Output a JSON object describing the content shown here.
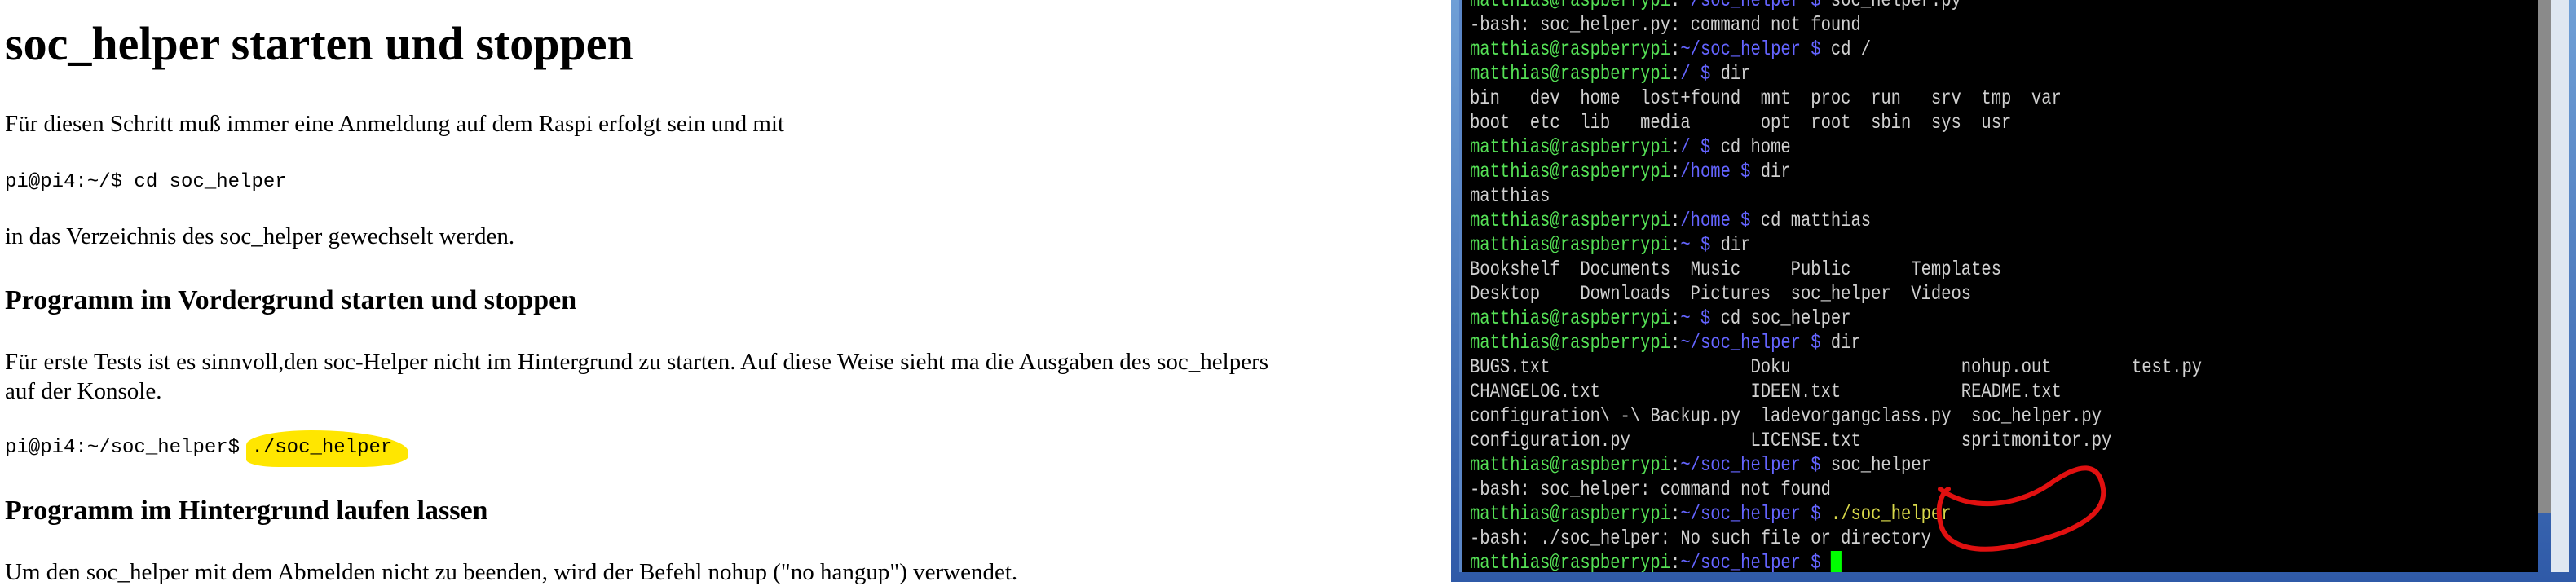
{
  "doc": {
    "title": "soc_helper starten und stoppen",
    "p1": "Für diesen Schritt muß immer eine Anmeldung auf dem Raspi erfolgt sein und mit",
    "code1": "pi@pi4:~/$ cd soc_helper",
    "p2": "in das Verzeichnis des soc_helper gewechselt werden.",
    "h2a": "Programm im Vordergrund starten und stoppen",
    "p3a": "Für erste Tests ist es sinnvoll,den soc-Helper nicht im Hintergrund zu starten. Auf diese Weise sieht ma die Ausgaben des soc_helpers",
    "p3b": "auf der Konsole.",
    "code2_prompt": "pi@pi4:~/soc_helper$ ",
    "code2_cmd": "./soc_helper",
    "h2b": "Programm im Hintergrund laufen lassen",
    "p4": "Um den soc_helper mit dem Abmelden nicht zu beenden, wird der Befehl nohup (\"no hangup\") verwendet."
  },
  "terminal": {
    "colors": {
      "user": "#55e055",
      "path": "#6464ff",
      "text": "#d0d0d0",
      "highlight": "#d8d84a",
      "cursor": "#00ff00",
      "annotation": "#e01010"
    },
    "lines": [
      [
        [
          "g",
          "matthias@raspberrypi"
        ],
        [
          "w",
          ":"
        ],
        [
          "b",
          "~/soc_helper $ "
        ],
        [
          "w",
          "soc_helper.py"
        ]
      ],
      [
        [
          "w",
          "-bash: soc_helper.py: command not found"
        ]
      ],
      [
        [
          "g",
          "matthias@raspberrypi"
        ],
        [
          "w",
          ":"
        ],
        [
          "b",
          "~/soc_helper $ "
        ],
        [
          "w",
          "cd /"
        ]
      ],
      [
        [
          "g",
          "matthias@raspberrypi"
        ],
        [
          "w",
          ":"
        ],
        [
          "b",
          "/ $ "
        ],
        [
          "w",
          "dir"
        ]
      ],
      [
        [
          "w",
          "bin   dev  home  lost+found  mnt  proc  run   srv  tmp  var"
        ]
      ],
      [
        [
          "w",
          "boot  etc  lib   media       opt  root  sbin  sys  usr"
        ]
      ],
      [
        [
          "g",
          "matthias@raspberrypi"
        ],
        [
          "w",
          ":"
        ],
        [
          "b",
          "/ $ "
        ],
        [
          "w",
          "cd home"
        ]
      ],
      [
        [
          "g",
          "matthias@raspberrypi"
        ],
        [
          "w",
          ":"
        ],
        [
          "b",
          "/home $ "
        ],
        [
          "w",
          "dir"
        ]
      ],
      [
        [
          "w",
          "matthias"
        ]
      ],
      [
        [
          "g",
          "matthias@raspberrypi"
        ],
        [
          "w",
          ":"
        ],
        [
          "b",
          "/home $ "
        ],
        [
          "w",
          "cd matthias"
        ]
      ],
      [
        [
          "g",
          "matthias@raspberrypi"
        ],
        [
          "w",
          ":"
        ],
        [
          "b",
          "~ $ "
        ],
        [
          "w",
          "dir"
        ]
      ],
      [
        [
          "w",
          "Bookshelf  Documents  Music     Public      Templates"
        ]
      ],
      [
        [
          "w",
          "Desktop    Downloads  Pictures  soc_helper  Videos"
        ]
      ],
      [
        [
          "g",
          "matthias@raspberrypi"
        ],
        [
          "w",
          ":"
        ],
        [
          "b",
          "~ $ "
        ],
        [
          "w",
          "cd soc_helper"
        ]
      ],
      [
        [
          "g",
          "matthias@raspberrypi"
        ],
        [
          "w",
          ":"
        ],
        [
          "b",
          "~/soc_helper $ "
        ],
        [
          "w",
          "dir"
        ]
      ],
      [
        [
          "w",
          "BUGS.txt                    Doku                 nohup.out        test.py"
        ]
      ],
      [
        [
          "w",
          "CHANGELOG.txt               IDEEN.txt            README.txt"
        ]
      ],
      [
        [
          "w",
          "configuration\\ -\\ Backup.py  ladevorgangclass.py  soc_helper.py"
        ]
      ],
      [
        [
          "w",
          "configuration.py            LICENSE.txt          spritmonitor.py"
        ]
      ],
      [
        [
          "g",
          "matthias@raspberrypi"
        ],
        [
          "w",
          ":"
        ],
        [
          "b",
          "~/soc_helper $ "
        ],
        [
          "w",
          "soc_helper"
        ]
      ],
      [
        [
          "w",
          "-bash: soc_helper: command not found"
        ]
      ],
      [
        [
          "g",
          "matthias@raspberrypi"
        ],
        [
          "w",
          ":"
        ],
        [
          "b",
          "~/soc_helper $ "
        ],
        [
          "y",
          "./soc_helper"
        ]
      ],
      [
        [
          "w",
          "-bash: ./soc_helper: No such file or directory"
        ]
      ],
      [
        [
          "g",
          "matthias@raspberrypi"
        ],
        [
          "w",
          ":"
        ],
        [
          "b",
          "~/soc_helper $ "
        ]
      ]
    ]
  }
}
